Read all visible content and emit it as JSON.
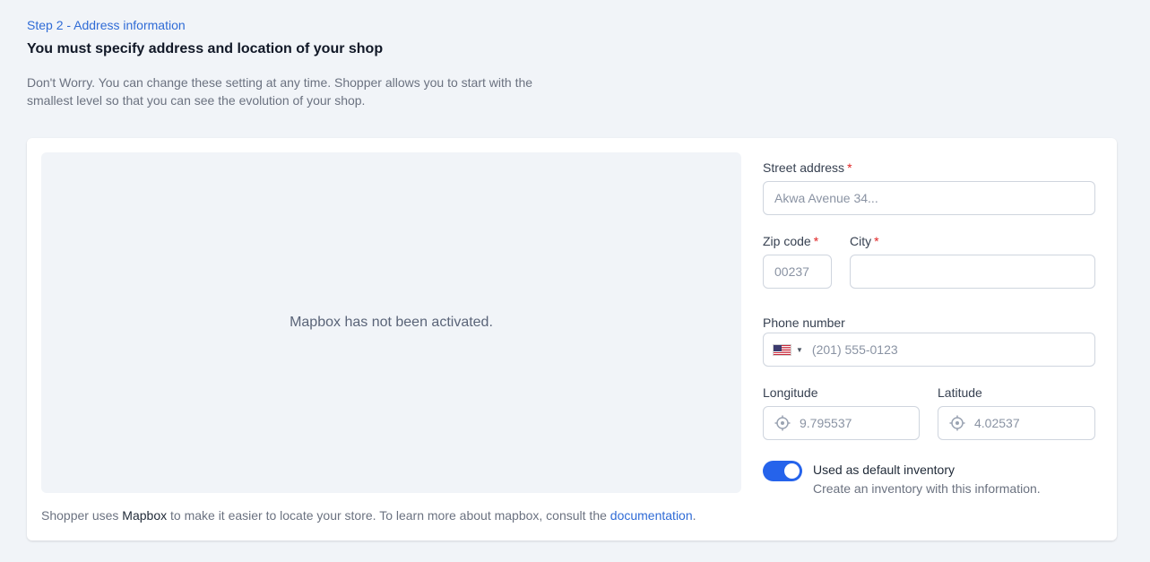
{
  "header": {
    "step_label": "Step 2 - Address information",
    "title": "You must specify address and location of your shop",
    "description": "Don't Worry. You can change these setting at any time. Shopper allows you to start with the smallest level so that you can see the evolution of your shop."
  },
  "map": {
    "message": "Mapbox has not been activated.",
    "note_prefix": "Shopper uses",
    "note_brand": "Mapbox",
    "note_middle": "to make it easier to locate your store. To learn more about mapbox, consult the",
    "note_link": "documentation",
    "note_suffix": "."
  },
  "form": {
    "street": {
      "label": "Street address",
      "required_mark": "*",
      "placeholder": "Akwa Avenue 34..."
    },
    "zip": {
      "label": "Zip code",
      "required_mark": "*",
      "placeholder": "00237"
    },
    "city": {
      "label": "City",
      "required_mark": "*",
      "value": ""
    },
    "phone": {
      "label": "Phone number",
      "country_icon": "us-flag-icon",
      "placeholder": "(201) 555-0123"
    },
    "longitude": {
      "label": "Longitude",
      "icon": "crosshair-icon",
      "placeholder": "9.795537"
    },
    "latitude": {
      "label": "Latitude",
      "icon": "crosshair-icon",
      "placeholder": "4.02537"
    },
    "default_inventory": {
      "enabled": true,
      "title": "Used as default inventory",
      "description": "Create an inventory with this information."
    }
  },
  "colors": {
    "accent": "#2563eb",
    "link": "#2f6bd6",
    "required": "#e02424",
    "background": "#f1f4f8"
  }
}
